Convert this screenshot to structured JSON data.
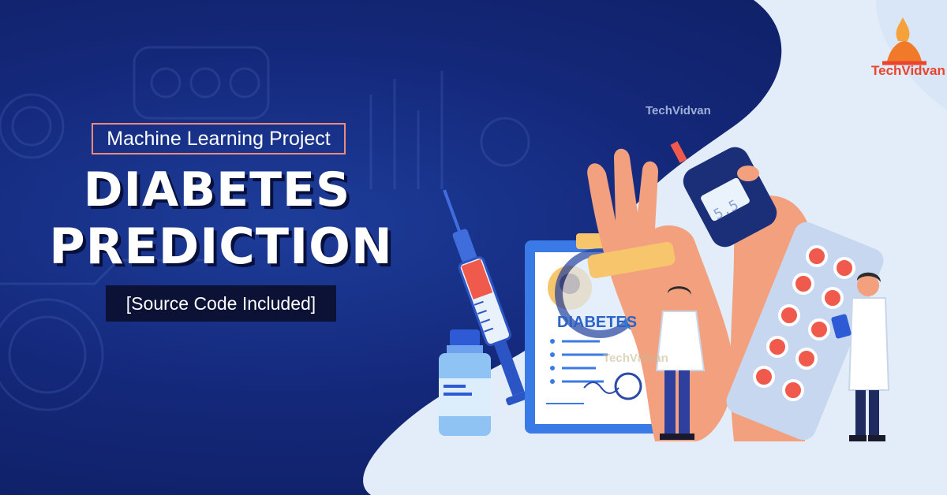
{
  "banner": {
    "tag": "Machine Learning Project",
    "headline_line1": "DIABETES",
    "headline_line2": "PREDICTION",
    "subtag": "[Source Code Included]"
  },
  "logo": {
    "brand": "TechVidvan",
    "brand_part1": "Tech",
    "brand_part2": "Vidvan"
  },
  "illustration": {
    "clipboard_label": "DIABETES",
    "meter_reading": "5.5",
    "watermark": "TechVidvan"
  },
  "colors": {
    "background": "#14287a",
    "accent_border": "#f08a7a",
    "headline": "#ffffff",
    "panel": "#e3edf9",
    "logo": "#e8452c"
  }
}
